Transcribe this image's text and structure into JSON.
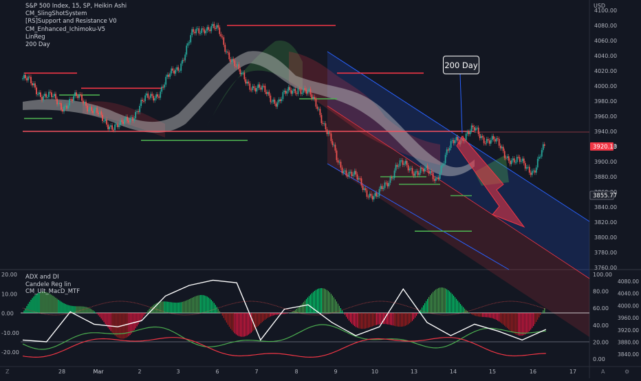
{
  "legend_main": [
    "S&P 500 Index, 15, SP, Heikin Ashi",
    "CM_SlingShotSystem",
    "[RS]Support and Resistance V0",
    "CM_Enhanced_Ichimoku-V5",
    "LinReg",
    "200 Day"
  ],
  "legend_sub": [
    "ADX and DI",
    "Candele Reg lin",
    "CM_Ult_MacD_MTF"
  ],
  "currency": "USD",
  "callout_label": "200 Day",
  "price_badges": {
    "current": "3920.13",
    "secondary": "3855.77"
  },
  "axis_bottom_left_glyph": "Z",
  "axis_bottom_right_glyphs": [
    "A",
    "⚙"
  ],
  "colors": {
    "bg": "#131722",
    "up": "#26a69a",
    "down": "#ef5350",
    "resistance": "#f23645",
    "support": "#4caf50",
    "channel": "#2962ff"
  },
  "chart_data": [
    {
      "type": "line",
      "title": "S&P 500 Index, 15, SP, Heikin Ashi",
      "x_ticks": [
        "28",
        "Mar",
        "2",
        "3",
        "6",
        "7",
        "8",
        "9",
        "10",
        "13",
        "14",
        "15",
        "16",
        "17"
      ],
      "y_ticks": [
        3760,
        3780,
        3800,
        3820,
        3840,
        3860,
        3880,
        3900,
        3920,
        3940,
        3960,
        3980,
        4000,
        4020,
        4040,
        4060,
        4080,
        4100
      ],
      "ylim": [
        3755,
        4105
      ],
      "series": [
        {
          "name": "Heikin Ashi close (approx)",
          "x": [
            0,
            0.5,
            1,
            1.5,
            2,
            2.5,
            3,
            3.5,
            4,
            4.3,
            4.6,
            5,
            5.5,
            6,
            6.5,
            7,
            7.5,
            8,
            8.5,
            9,
            9.5,
            10,
            10.5,
            11,
            11.5,
            12,
            12.5,
            13,
            13.3
          ],
          "values": [
            4010,
            3990,
            3975,
            3985,
            3955,
            3945,
            3975,
            3995,
            4030,
            4065,
            4080,
            4070,
            4015,
            3995,
            3980,
            4000,
            3975,
            3900,
            3875,
            3850,
            3895,
            3890,
            3880,
            3930,
            3940,
            3925,
            3900,
            3890,
            3920
          ]
        }
      ],
      "levels": {
        "resistance": [
          4017,
          3997,
          4080,
          4017,
          3940
        ],
        "support": [
          3957,
          3928,
          3983,
          3880,
          3855,
          3808
        ]
      },
      "price_labels": [
        "3920.13",
        "3855.77"
      ]
    },
    {
      "type": "line",
      "title": "ADX and DI / CM_Ult_MacD_MTF",
      "y_ticks_left": [
        20.0,
        10.0,
        0.0,
        -10.0,
        -20.0
      ],
      "y_ticks_right": [
        100.0,
        80.0,
        60.0,
        40.0,
        20.0,
        0.0
      ],
      "y_ticks_price": [
        4080.0,
        4040.0,
        4000.0,
        3960.0,
        3920.0,
        3880.0,
        3840.0
      ],
      "series": [
        {
          "name": "ADX",
          "values": [
            20,
            18,
            52,
            38,
            35,
            42,
            70,
            82,
            88,
            85,
            20,
            55,
            60,
            40,
            25,
            35,
            78,
            40,
            25,
            38,
            30,
            20,
            32
          ]
        }
      ]
    }
  ]
}
